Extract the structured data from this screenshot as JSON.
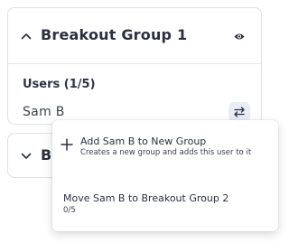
{
  "groups": [
    {
      "title": "Breakout Group 1",
      "expanded": true,
      "users_label": "Users (1/5)",
      "users": [
        {
          "name": "Sam B"
        }
      ]
    },
    {
      "title": "Br",
      "expanded": false
    }
  ],
  "menu": {
    "add_new": {
      "title": "Add Sam B to New Group",
      "subtitle": "Creates a new group and adds this user to it"
    },
    "move": {
      "title": "Move Sam B to Breakout Group 2",
      "count": "0/5"
    }
  },
  "colors": {
    "text": "#2a3040",
    "border": "#dfe1e6",
    "swap_button_bg": "#e9edf5"
  },
  "icons": {
    "collapse": "chevron-up-icon",
    "expand": "chevron-down-icon",
    "visibility": "eye-icon",
    "move_user": "swap-arrows-icon",
    "add": "plus-icon"
  }
}
